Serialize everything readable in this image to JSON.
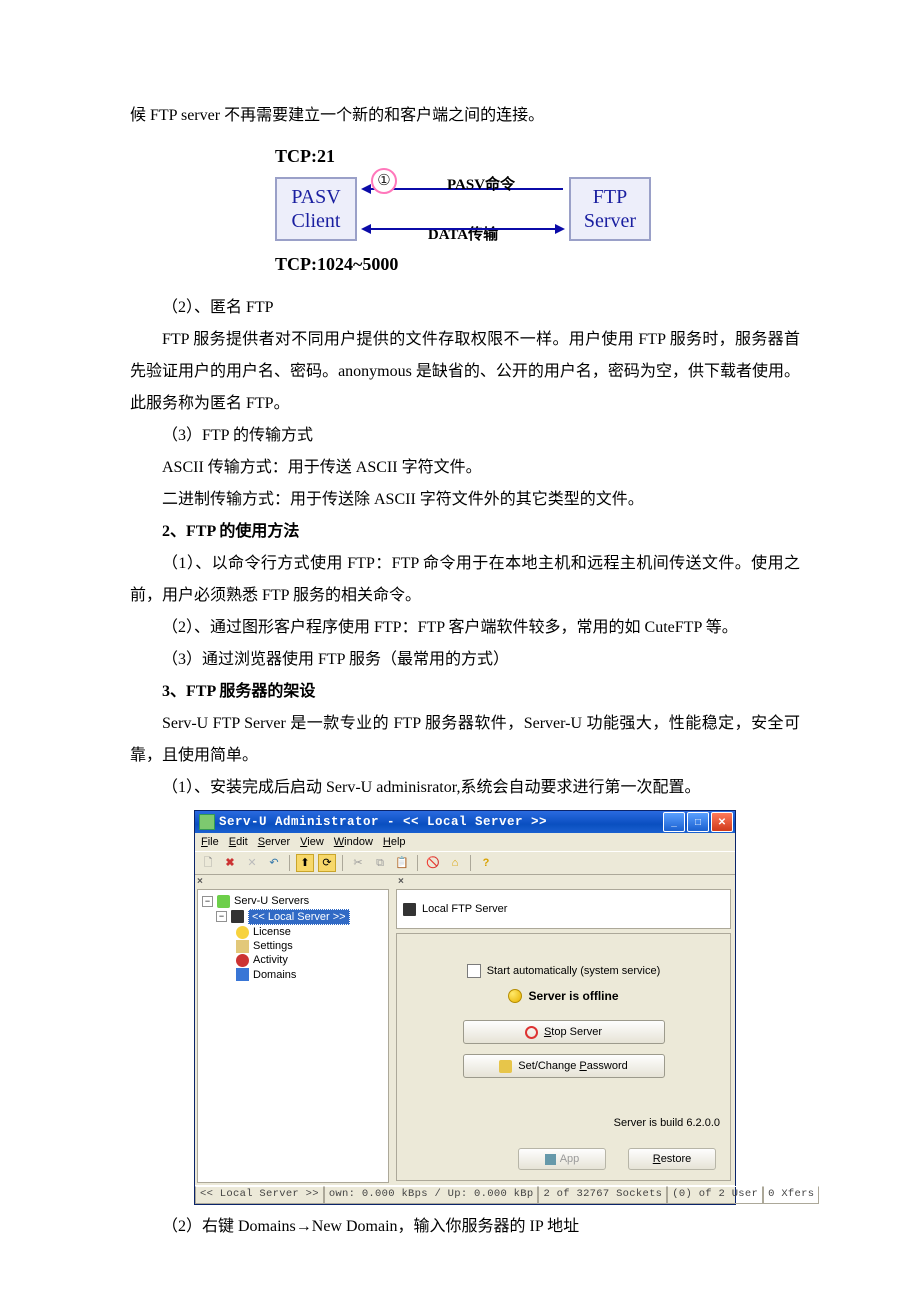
{
  "top_line": "候 FTP server 不再需要建立一个新的和客户端之间的连接。",
  "pasv_diagram": {
    "tcp21": "TCP:21",
    "left_box_l1": "PASV",
    "left_box_l2": "Client",
    "right_box_l1": "FTP",
    "right_box_l2": "Server",
    "circle": "①",
    "arrow1_label": "PASV命令",
    "arrow2_label": "DATA传输",
    "bottom_label": "TCP:1024~5000"
  },
  "sec2_title": "（2）、匿名 FTP",
  "sec2_para": "FTP 服务提供者对不同用户提供的文件存取权限不一样。用户使用 FTP 服务时，服务器首先验证用户的用户名、密码。anonymous 是缺省的、公开的用户名，密码为空，供下载者使用。此服务称为匿名 FTP。",
  "sec3_title": "（3）FTP 的传输方式",
  "sec3_line1": "ASCII 传输方式：用于传送 ASCII 字符文件。",
  "sec3_line2": "二进制传输方式：用于传送除 ASCII 字符文件外的其它类型的文件。",
  "h2": "2、FTP 的使用方法",
  "h2_p1": "（1）、以命令行方式使用 FTP：FTP 命令用于在本地主机和远程主机间传送文件。使用之前，用户必须熟悉 FTP 服务的相关命令。",
  "h2_p2": "（2）、通过图形客户程序使用 FTP：FTP 客户端软件较多，常用的如 CuteFTP 等。",
  "h2_p3": "（3）通过浏览器使用 FTP 服务（最常用的方式）",
  "h3": "3、FTP 服务器的架设",
  "h3_p1": "Serv-U FTP Server 是一款专业的 FTP 服务器软件，Server-U 功能强大，性能稳定，安全可靠，且使用简单。",
  "h3_p2": "（1）、安装完成后启动 Serv-U adminisrator,系统会自动要求进行第一次配置。",
  "window": {
    "title": "Serv-U Administrator - << Local Server >>",
    "menus": {
      "file": "File",
      "edit": "Edit",
      "server": "Server",
      "view": "View",
      "window": "Window",
      "help": "Help"
    },
    "tree": {
      "root": "Serv-U Servers",
      "local": "<< Local Server >>",
      "license": "License",
      "settings": "Settings",
      "activity": "Activity",
      "domains": "Domains"
    },
    "right_header": "Local FTP Server",
    "checkbox_label": "Start automatically (system service)",
    "status_text": "Server is offline",
    "btn_stop": "Stop Server",
    "btn_stop_ul": "S",
    "btn_pwd": "Set/Change Password",
    "btn_pwd_ul": "P",
    "build": "Server is build 6.2.0.0",
    "btn_apply": "App",
    "btn_restore": "Restore",
    "btn_restore_ul": "R",
    "status1": "<< Local Server >>",
    "status2": "own: 0.000 kBps / Up: 0.000 kBp",
    "status3": "2 of 32767 Sockets",
    "status4": "(0) of 2 User",
    "status5": "0 Xfers"
  },
  "last_line": "（2）右键 Domains→New Domain，输入你服务器的 IP 地址"
}
